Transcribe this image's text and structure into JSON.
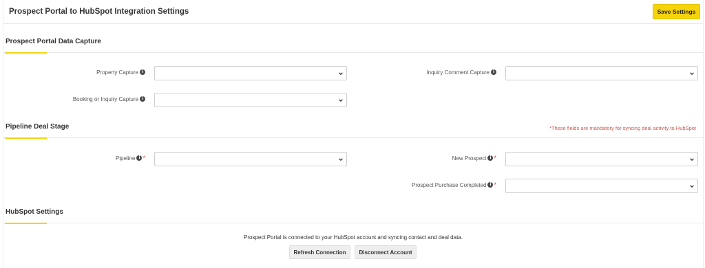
{
  "header": {
    "title": "Prospect Portal to HubSpot Integration Settings",
    "save_label": "Save Settings"
  },
  "sections": {
    "data_capture": {
      "title": "Prospect Portal Data Capture",
      "fields": {
        "property_capture": {
          "label": "Property Capture",
          "value": ""
        },
        "inquiry_comment_capture": {
          "label": "Inquiry Comment Capture",
          "value": ""
        },
        "booking_inquiry_capture": {
          "label": "Booking or Inquiry Capture",
          "value": ""
        }
      }
    },
    "pipeline": {
      "title": "Pipeline Deal Stage",
      "note": "*These fields are mandatory for syncing deal activity to HubSpot",
      "fields": {
        "pipeline": {
          "label": "Pipeline",
          "value": ""
        },
        "new_prospect": {
          "label": "New Prospect",
          "value": ""
        },
        "purchase_completed": {
          "label": "Prospect Purchase Completed",
          "value": ""
        }
      }
    },
    "hubspot": {
      "title": "HubSpot Settings",
      "status": "Prospect Portal is connected to your HubSpot account and syncing contact and deal data.",
      "refresh_label": "Refresh Connection",
      "disconnect_label": "Disconnect Account"
    }
  },
  "icons": {
    "info": "info-icon",
    "dropdown": "chevron-down-icon"
  },
  "colors": {
    "accent": "#f6d40a",
    "required": "#d9413a",
    "note": "#d0554b"
  },
  "glyphs": {
    "info": "i",
    "required": "*"
  }
}
